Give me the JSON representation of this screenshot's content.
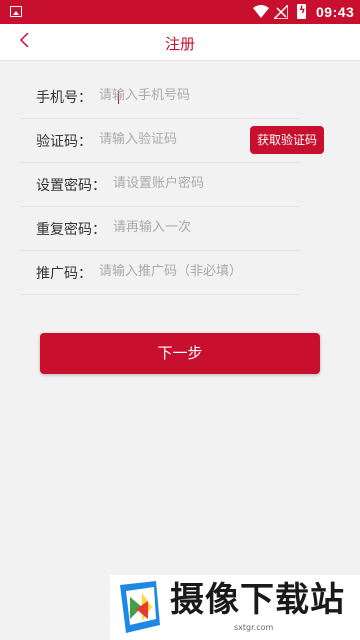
{
  "status_bar": {
    "time": "09:43",
    "icons": [
      "image-icon",
      "wifi-icon",
      "signal-icon",
      "battery-charging-icon"
    ],
    "color": "#c8102e"
  },
  "nav": {
    "title": "注册",
    "back_icon": "chevron-left-icon"
  },
  "form": {
    "phone": {
      "label": "手机号：",
      "placeholder": "请输入手机号码"
    },
    "code": {
      "label": "验证码：",
      "placeholder": "请输入验证码",
      "button": "获取验证码"
    },
    "password": {
      "label": "设置密码：",
      "placeholder": "请设置账户密码"
    },
    "confirm": {
      "label": "重复密码：",
      "placeholder": "请再输入一次"
    },
    "referral": {
      "label": "推广码：",
      "placeholder": "请输入推广码（非必填）"
    }
  },
  "next_button": "下一步",
  "watermark": {
    "text": "摄像下载站",
    "url": "sxtgr.com"
  },
  "accent_color": "#c8102e"
}
